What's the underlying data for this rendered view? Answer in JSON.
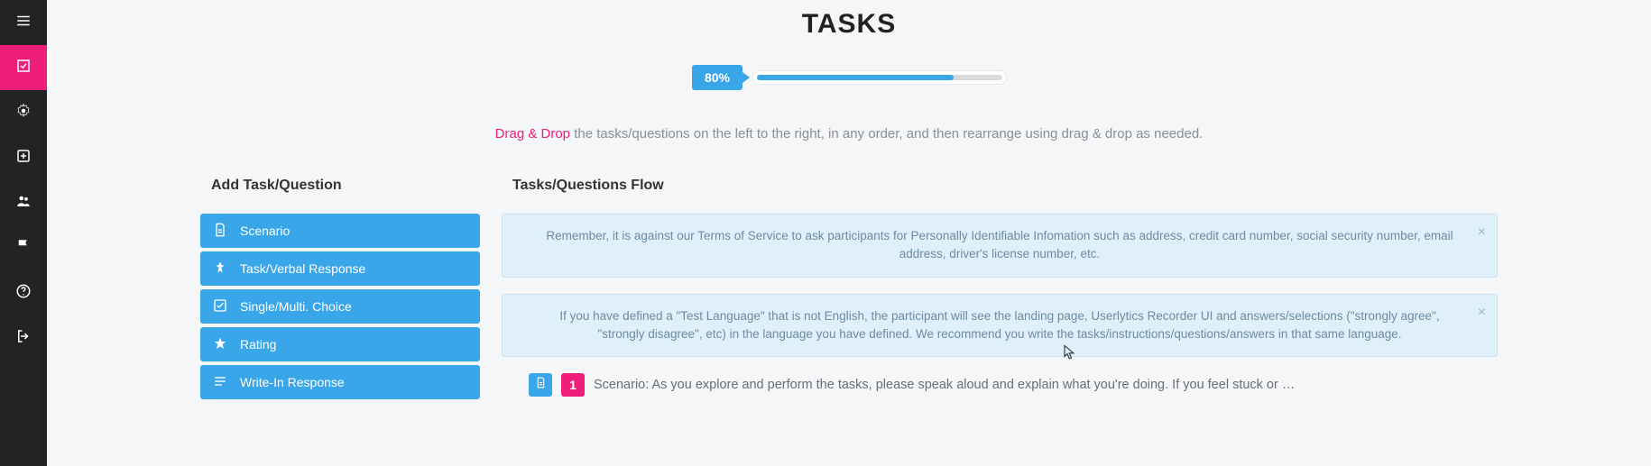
{
  "page": {
    "title": "TASKS"
  },
  "progress": {
    "percent_label": "80%",
    "percent_value": 80
  },
  "hint": {
    "accent": "Drag & Drop",
    "rest": " the tasks/questions on the left to the right, in any order, and then rearrange using drag & drop as needed."
  },
  "left": {
    "heading": "Add Task/Question",
    "items": [
      {
        "icon": "file-icon",
        "label": "Scenario"
      },
      {
        "icon": "pin-icon",
        "label": "Task/Verbal Response"
      },
      {
        "icon": "check-icon",
        "label": "Single/Multi. Choice"
      },
      {
        "icon": "star-icon",
        "label": "Rating"
      },
      {
        "icon": "lines-icon",
        "label": "Write-In Response"
      }
    ]
  },
  "right": {
    "heading": "Tasks/Questions Flow",
    "notices": [
      "Remember, it is against our Terms of Service to ask participants for Personally Identifiable Infomation such as address, credit card number, social security number, email address, driver's license number, etc.",
      "If you have defined a \"Test Language\" that is not English, the participant will see the landing page, Userlytics Recorder UI and answers/selections (\"strongly agree\", \"strongly disagree\", etc) in the language you have defined. We recommend you write the tasks/instructions/questions/answers in that same language."
    ],
    "flow": [
      {
        "index": "1",
        "type_icon": "file-icon",
        "text": "Scenario: As you explore and perform the tasks, please speak aloud and explain what you're doing. If you feel stuck or unsure about how to p…"
      }
    ]
  },
  "nav": {
    "items": [
      {
        "id": "menu-icon",
        "active": false
      },
      {
        "id": "tasks-icon",
        "active": true
      },
      {
        "id": "gear-icon",
        "active": false
      },
      {
        "id": "plus-icon",
        "active": false
      },
      {
        "id": "people-icon",
        "active": false
      },
      {
        "id": "flag-icon",
        "active": false
      },
      {
        "id": "help-icon",
        "active": false
      },
      {
        "id": "signout-icon",
        "active": false
      }
    ]
  },
  "colors": {
    "accent_blue": "#3aa6ea",
    "accent_pink": "#ef1e7b",
    "notice_bg": "#e0f0fa"
  }
}
